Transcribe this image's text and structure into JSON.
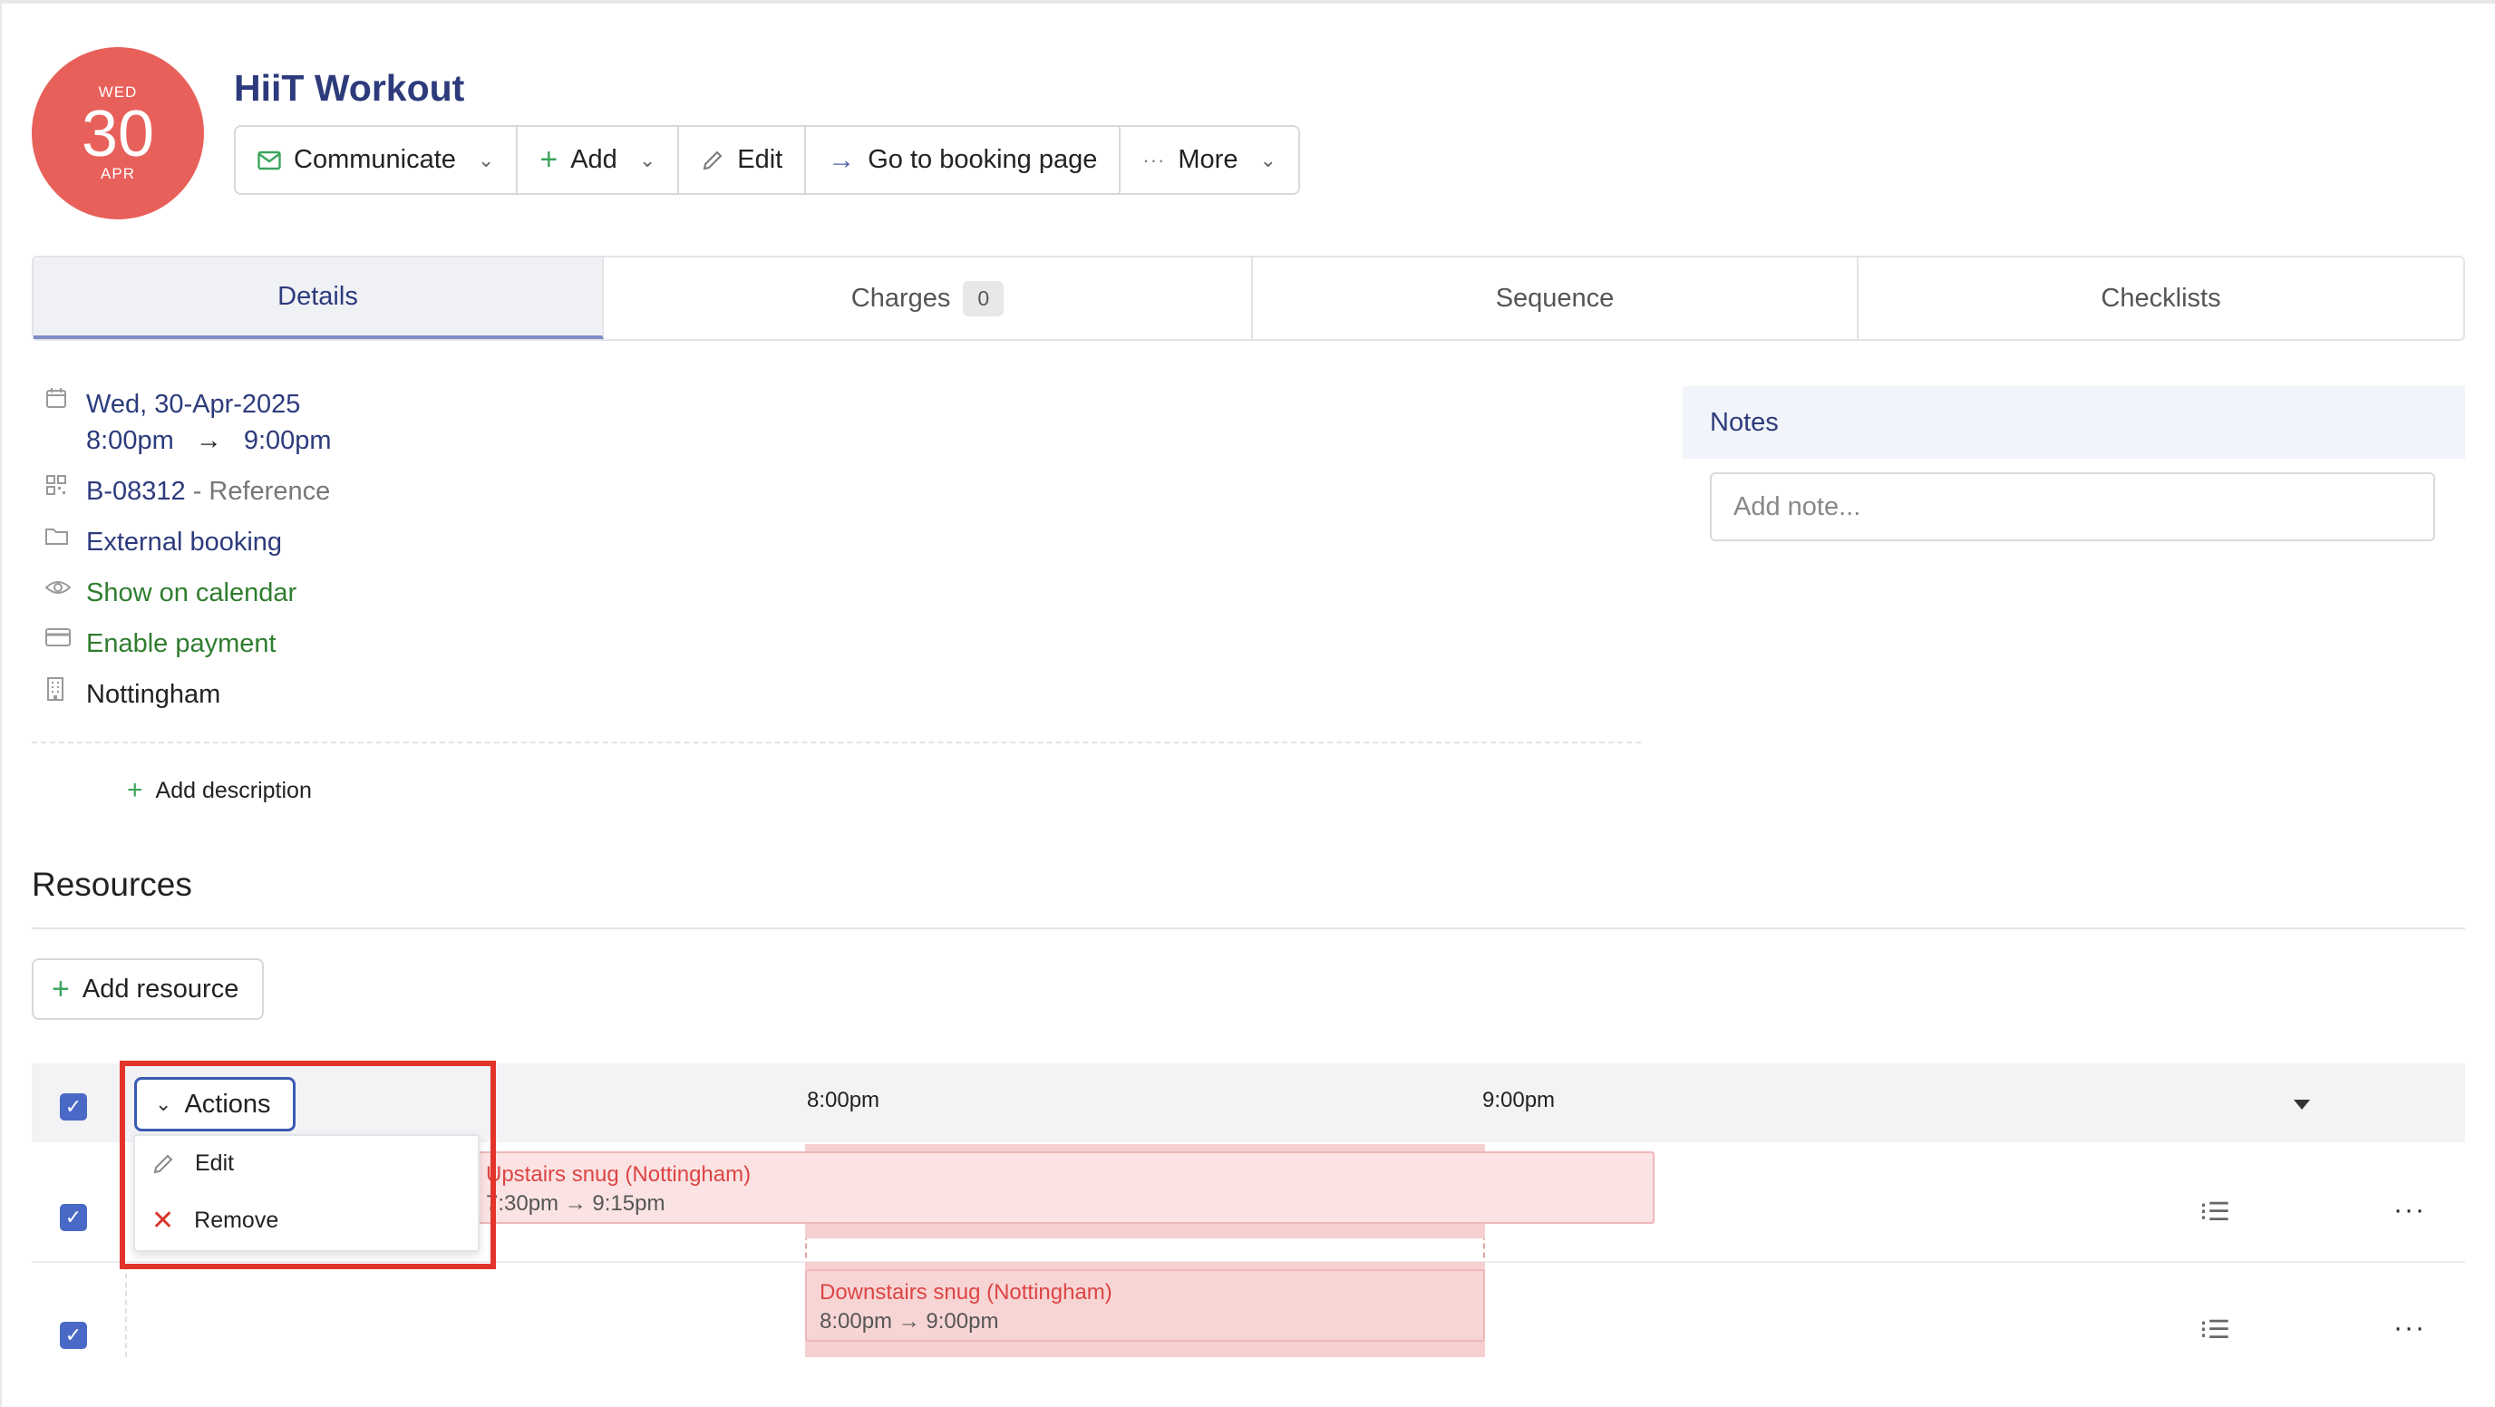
{
  "event": {
    "date_badge": {
      "weekday": "WED",
      "day": "30",
      "month": "APR"
    },
    "title": "HiiT Workout"
  },
  "toolbar": {
    "communicate": "Communicate",
    "add": "Add",
    "edit": "Edit",
    "go_to_booking": "Go to booking page",
    "more": "More"
  },
  "tabs": [
    {
      "label": "Details",
      "active": true
    },
    {
      "label": "Charges",
      "count": "0"
    },
    {
      "label": "Sequence"
    },
    {
      "label": "Checklists"
    }
  ],
  "details": {
    "date": "Wed, 30-Apr-2025",
    "start_time": "8:00pm",
    "arrow": "→",
    "end_time": "9:00pm",
    "booking_ref": "B-08312",
    "reference_label": " - Reference",
    "booking_type": "External booking",
    "calendar_visibility": "Show on calendar",
    "payment": "Enable payment",
    "location": "Nottingham",
    "add_description": "Add description"
  },
  "notes": {
    "title": "Notes",
    "placeholder": "Add note..."
  },
  "resources": {
    "title": "Resources",
    "add_resource": "Add resource",
    "timeline_labels": [
      "8:00pm",
      "9:00pm"
    ],
    "rows": [
      {
        "name": "Upstairs snug (Nottingham)",
        "time": "7:30pm → 9:15pm",
        "checked": true
      },
      {
        "name": "Downstairs snug (Nottingham)",
        "time": "8:00pm → 9:00pm",
        "checked": true
      }
    ]
  },
  "actions_menu": {
    "button": "Actions",
    "items": [
      "Edit",
      "Remove"
    ]
  },
  "colors": {
    "brand_navy": "#2d3b7c",
    "badge_red": "#e8605a",
    "accent_green": "#3ba55c",
    "checkbox_blue": "#4a69c6",
    "highlight_red": "#e3342b"
  }
}
